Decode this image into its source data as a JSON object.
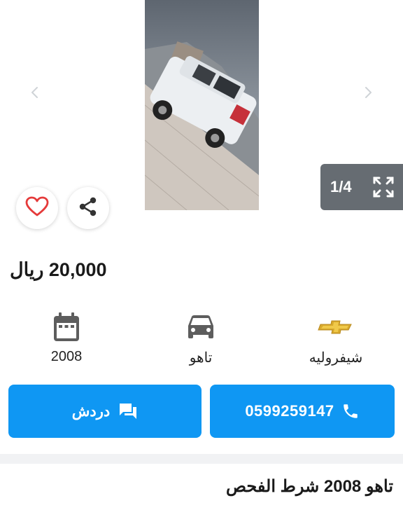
{
  "gallery": {
    "counter": "1/4"
  },
  "listing": {
    "price": "20,000 ريال",
    "title": "تاهو 2008 شرط الفحص"
  },
  "specs": {
    "brand": "شيفروليه",
    "model": "تاهو",
    "year": "2008"
  },
  "actions": {
    "call_label": "0599259147",
    "chat_label": "دردش"
  },
  "icons": {
    "favorite": "heart-icon",
    "share": "share-icon",
    "expand": "fullscreen-icon",
    "prev": "chevron-left-icon",
    "next": "chevron-right-icon",
    "brand": "chevrolet-logo-icon",
    "model": "car-icon",
    "year": "calendar-icon",
    "call": "phone-icon",
    "chat": "chat-icon"
  },
  "colors": {
    "primary": "#0f97f3",
    "heart": "#e53a3a",
    "overlay": "#666c72"
  }
}
